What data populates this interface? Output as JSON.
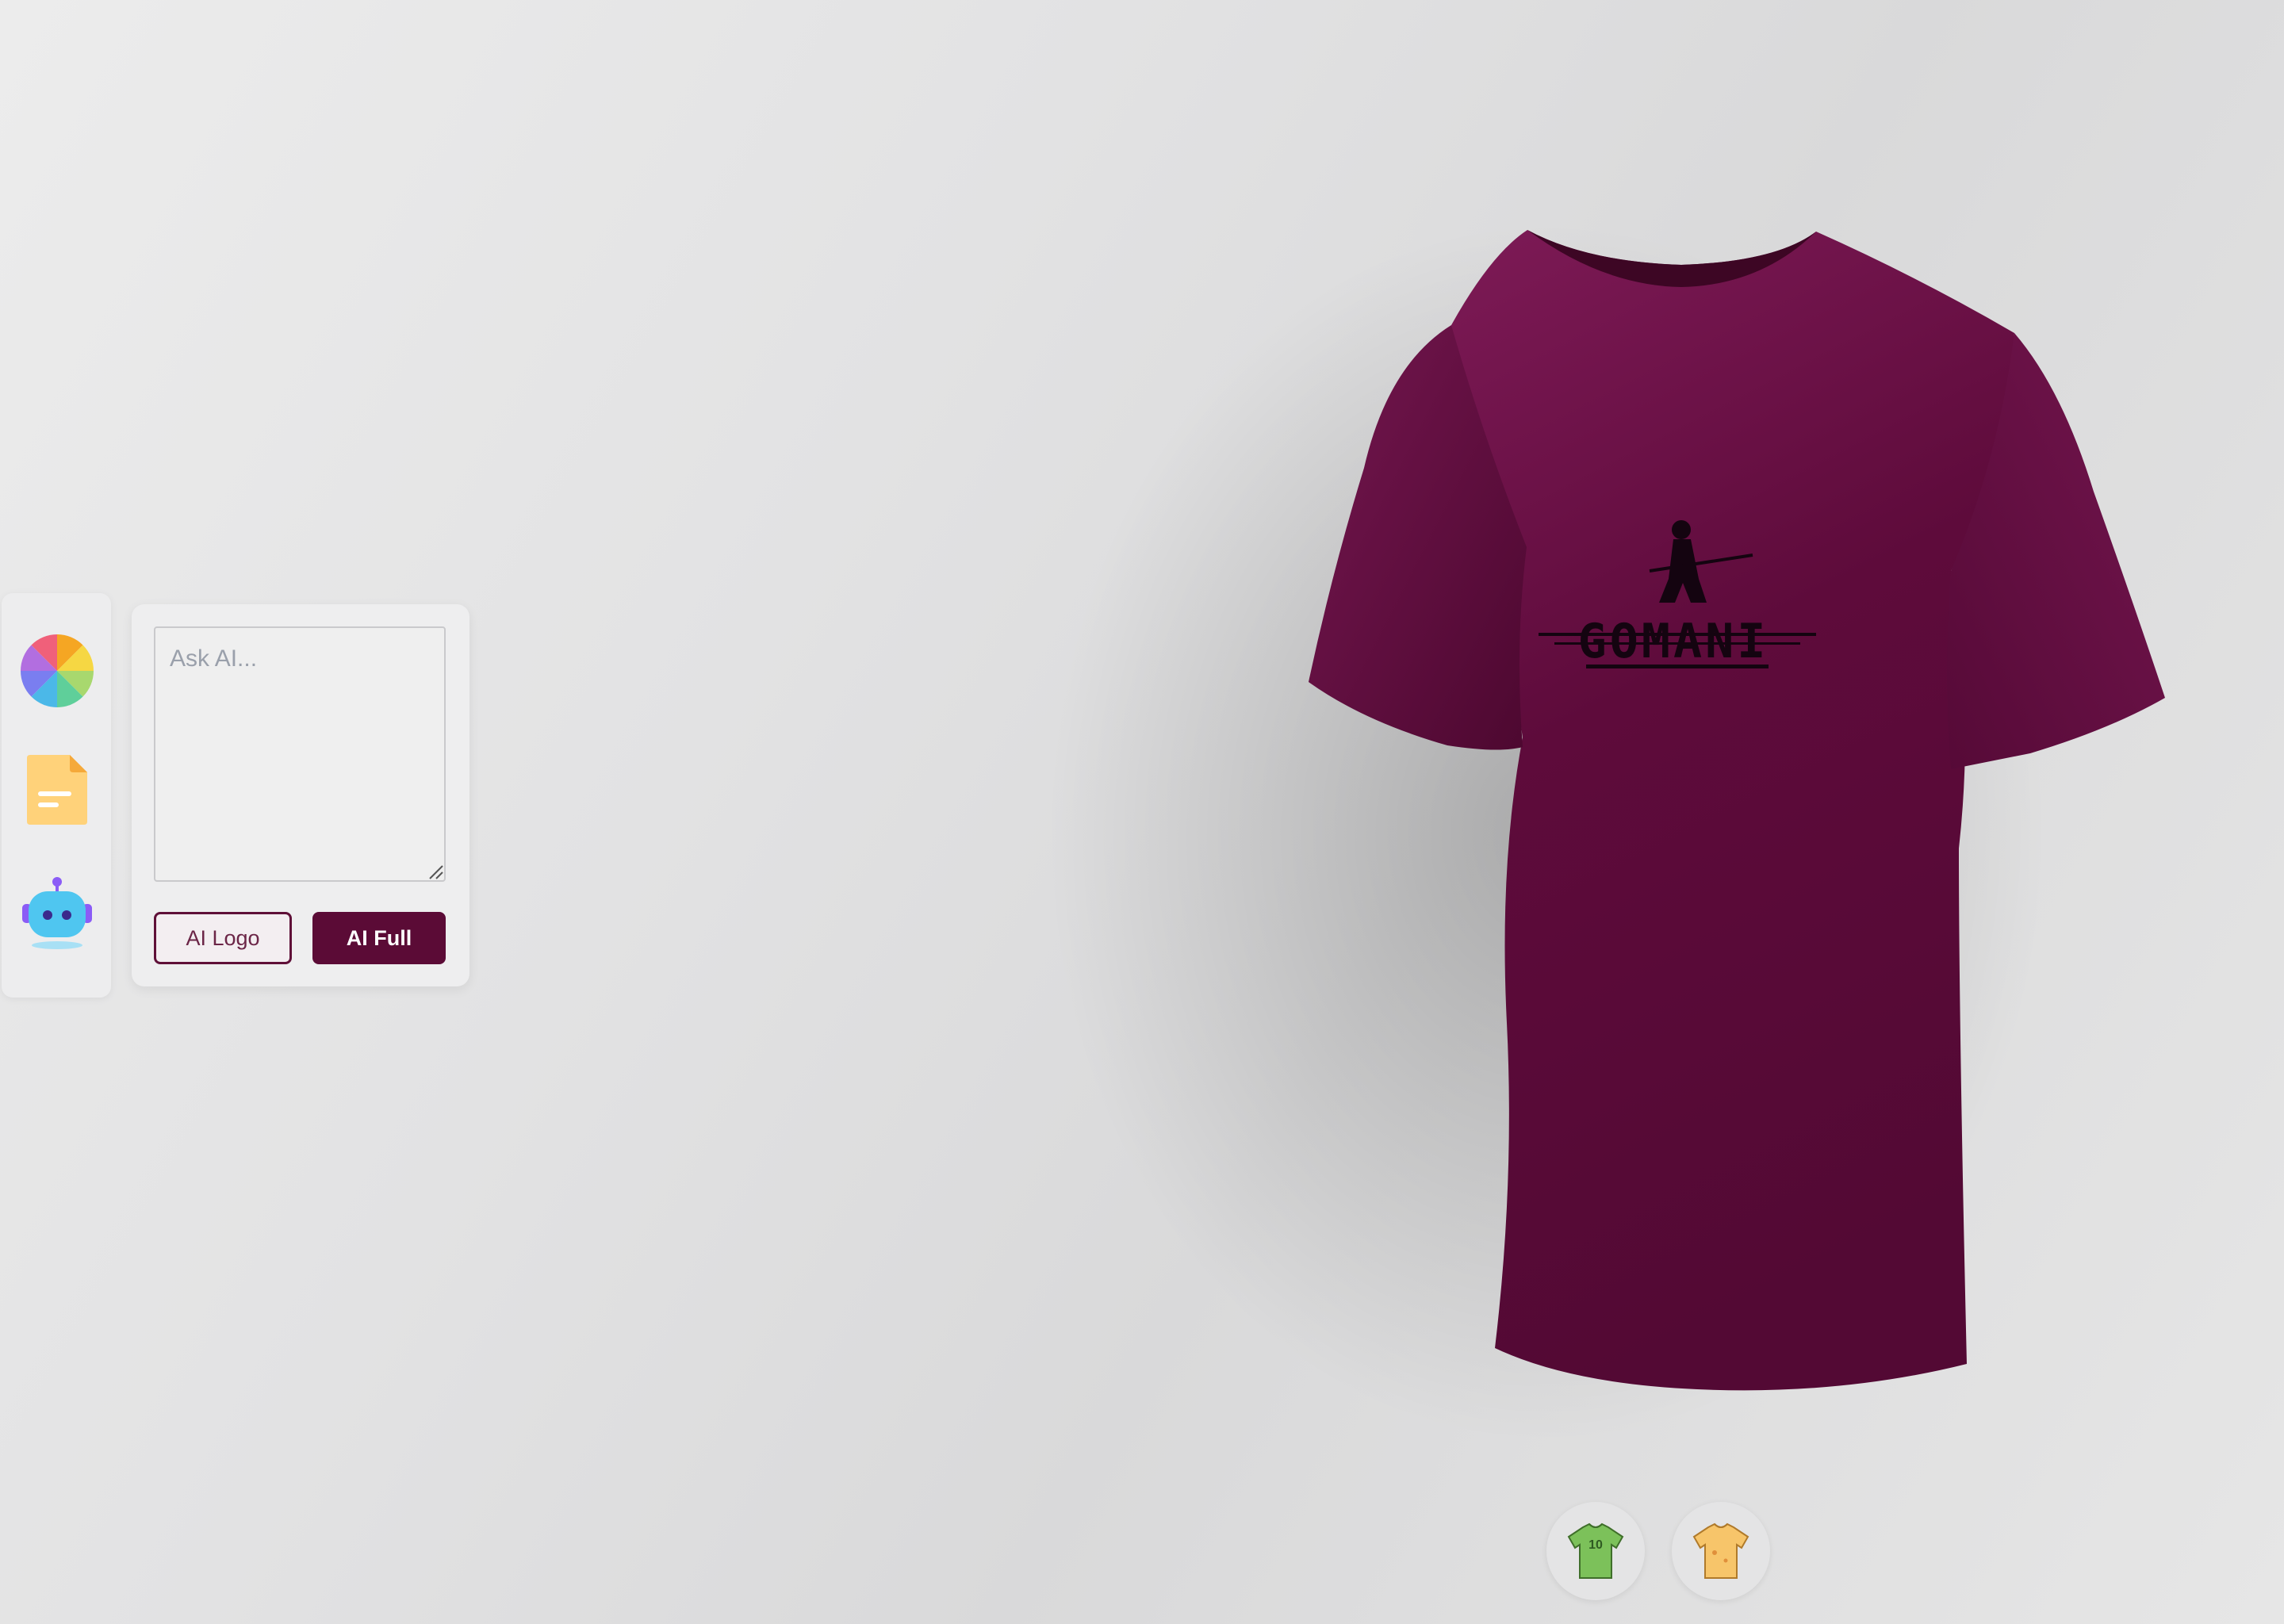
{
  "toolbar": {
    "items": [
      {
        "id": "color",
        "icon": "color-wheel-icon"
      },
      {
        "id": "file",
        "icon": "file-icon"
      },
      {
        "id": "ai",
        "icon": "robot-icon"
      }
    ]
  },
  "ai_panel": {
    "placeholder": "Ask AI...",
    "logo_button": "AI Logo",
    "full_button": "AI Full"
  },
  "shirt": {
    "color": "#6a0e45",
    "logo_text": "GOMANI"
  },
  "products": [
    {
      "id": "jersey",
      "icon": "jersey-icon",
      "number": "10"
    },
    {
      "id": "tshirt",
      "icon": "tshirt-icon"
    }
  ],
  "colors": {
    "accent": "#5b0b36",
    "panel_bg": "#eeeeef"
  }
}
